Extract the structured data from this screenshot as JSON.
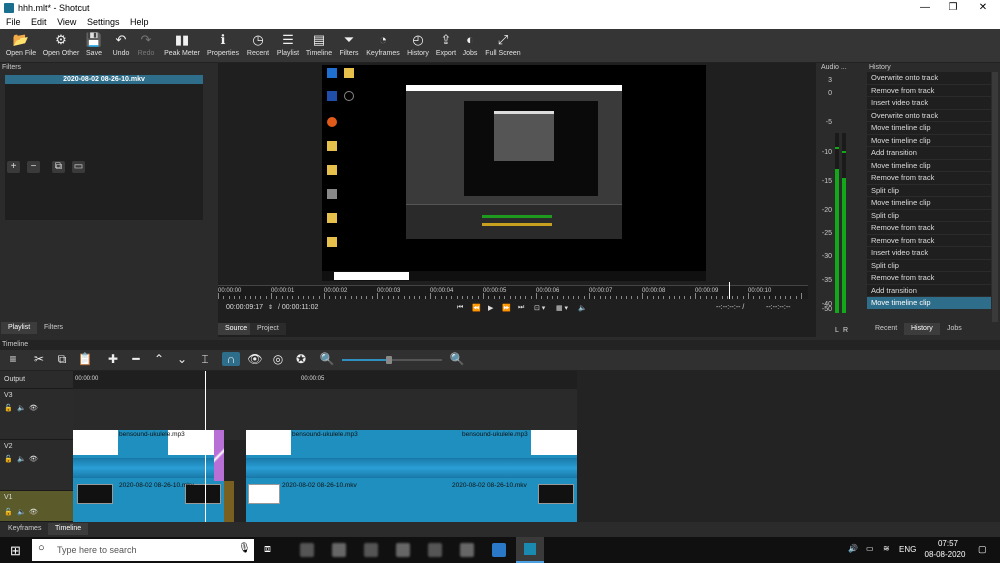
{
  "window": {
    "title": "hhh.mlt* - Shotcut",
    "minimize": "—",
    "maximize": "❐",
    "close": "✕"
  },
  "menu": [
    "File",
    "Edit",
    "View",
    "Settings",
    "Help"
  ],
  "toolbar": [
    {
      "label": "Open File",
      "icon": "📂",
      "enabled": true
    },
    {
      "label": "Open Other",
      "icon": "⚙",
      "enabled": true
    },
    {
      "label": "Save",
      "icon": "💾",
      "enabled": true
    },
    {
      "label": "Undo",
      "icon": "↶",
      "enabled": true
    },
    {
      "label": "Redo",
      "icon": "↷",
      "enabled": false
    },
    {
      "label": "Peak Meter",
      "icon": "▮▮",
      "enabled": true
    },
    {
      "label": "Properties",
      "icon": "ℹ",
      "enabled": true
    },
    {
      "label": "Recent",
      "icon": "◷",
      "enabled": true
    },
    {
      "label": "Playlist",
      "icon": "☰",
      "enabled": true
    },
    {
      "label": "Timeline",
      "icon": "▤",
      "enabled": true
    },
    {
      "label": "Filters",
      "icon": "⏷",
      "enabled": true
    },
    {
      "label": "Keyframes",
      "icon": "◔",
      "enabled": true
    },
    {
      "label": "History",
      "icon": "◴",
      "enabled": true
    },
    {
      "label": "Export",
      "icon": "⇪",
      "enabled": true
    },
    {
      "label": "Jobs",
      "icon": "◐",
      "enabled": true
    },
    {
      "label": "Full Screen",
      "icon": "⤢",
      "enabled": true
    }
  ],
  "filters": {
    "title": "Filters",
    "selected_clip": "2020-08-02 08-26-10.mkv",
    "tabs": [
      "Playlist",
      "Filters"
    ]
  },
  "viewer": {
    "ruler": [
      "00:00:00",
      "00:00:01",
      "00:00:02",
      "00:00:03",
      "00:00:04",
      "00:00:05",
      "00:00:06",
      "00:00:07",
      "00:00:08",
      "00:00:09",
      "00:00:10"
    ],
    "position": "00:00:09:17",
    "duration": "/ 00:00:11:02",
    "in_point": "--:--:--:-- /",
    "out_point": "--:--:--:--",
    "tabs": [
      "Source",
      "Project"
    ]
  },
  "audio": {
    "title": "Audio ...",
    "scale": [
      "3",
      "0",
      "-5",
      "-10",
      "-15",
      "-20",
      "-25",
      "-30",
      "-35",
      "-40",
      "-50"
    ],
    "channels": [
      "L",
      "R"
    ],
    "left_level": 0.8,
    "right_level": 0.75
  },
  "history": {
    "title": "History",
    "items": [
      "Overwrite onto track",
      "Remove from track",
      "Insert video track",
      "Overwrite onto track",
      "Move timeline clip",
      "Move timeline clip",
      "Add transition",
      "Move timeline clip",
      "Remove from track",
      "Split clip",
      "Move timeline clip",
      "Split clip",
      "Remove from track",
      "Remove from track",
      "Insert video track",
      "Split clip",
      "Remove from track",
      "Add transition",
      "Move timeline clip"
    ],
    "tabs": [
      "Recent",
      "History",
      "Jobs"
    ]
  },
  "timeline": {
    "title": "Timeline",
    "output": "Output",
    "times": [
      "00:00:00",
      "00:00:05"
    ],
    "tracks": [
      "V3",
      "V2",
      "V1"
    ],
    "audio_clip": "bensound-ukulele.mp3",
    "video_clip": "2020-08-02 08-26-10.mkv",
    "bottom_tabs": [
      "Keyframes",
      "Timeline"
    ]
  },
  "taskbar": {
    "search": "Type here to search",
    "lang": "ENG",
    "time": "07:57",
    "date": "08-08-2020"
  },
  "colors": {
    "accent": "#2e6e8a",
    "clip_blue": "#1f8fbf",
    "meter_green": "#12a81a",
    "transition": "#b86fd6",
    "v1_header": "#5a5a2a"
  }
}
